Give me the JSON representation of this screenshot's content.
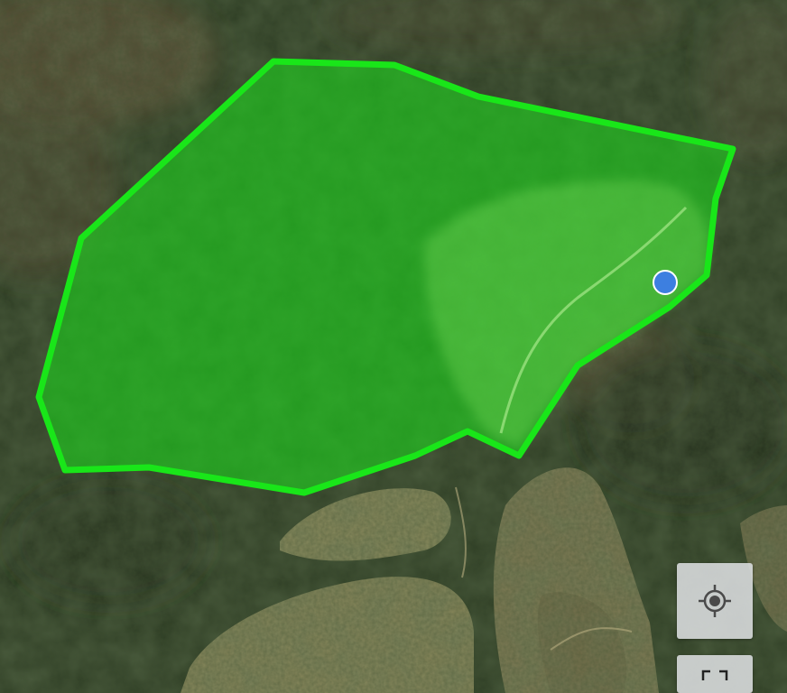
{
  "map": {
    "view": "satellite",
    "area_polygon": {
      "fill_color": "#1fd21f",
      "fill_opacity": 0.62,
      "stroke_color": "#19e619"
    },
    "location_marker": {
      "fill_color": "#3d7fe0",
      "border_color": "#ffffff"
    },
    "terrain_colors": {
      "forest_dark": "#23331b",
      "forest_mid": "#34452a",
      "clearing_pasture": "#8c8a5c",
      "bare_soil": "#6a5a40"
    }
  },
  "controls": {
    "locate": {
      "icon": "my-location-icon"
    },
    "fullscreen": {
      "icon": "fullscreen-icon"
    }
  }
}
